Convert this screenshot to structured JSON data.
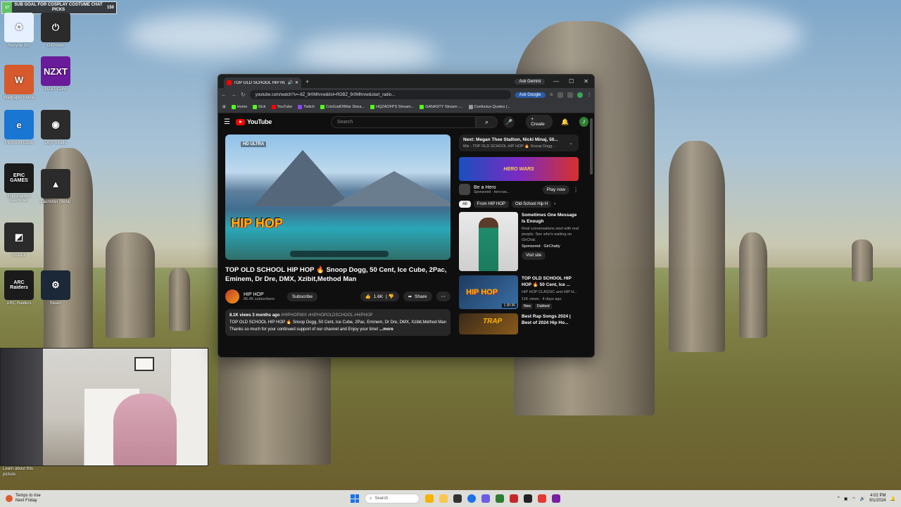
{
  "overlay": {
    "sub_goal_text": "SUB GOAL FOR COSPLAY COSTUME CHAT PICKS",
    "sub_goal_count": "150",
    "sub_goal_level": "17",
    "learn_more": "Learn about this picture"
  },
  "desktop_icons": [
    {
      "label": "Recycle Bin",
      "color": "#e6f0ff",
      "glyph": "♻"
    },
    {
      "label": "GitPower",
      "color": "#2b2b2b",
      "glyph": "⏻"
    },
    {
      "label": "Wallpaper Maste",
      "color": "#d65a2b",
      "glyph": "W"
    },
    {
      "label": "NZXT CAM",
      "color": "#6a1b9a",
      "glyph": "NZXT"
    },
    {
      "label": "Microsoft Edge",
      "color": "#1976d2",
      "glyph": "e"
    },
    {
      "label": "OBS Studio",
      "color": "#2b2b2b",
      "glyph": "◉"
    },
    {
      "label": "Epic Games Launcher",
      "color": "#1b1b1b",
      "glyph": "EPIC GAMES"
    },
    {
      "label": "Launcher (Beta)",
      "color": "#2b2b2b",
      "glyph": "▲"
    },
    {
      "label": "ShareX",
      "color": "#2b2b2b",
      "glyph": "◩"
    },
    {
      "label": "ARC Raiders",
      "color": "#1b1b1b",
      "glyph": "ARC Raiders"
    },
    {
      "label": "Steam",
      "color": "#1b2838",
      "glyph": "⚙"
    }
  ],
  "browser": {
    "tab_title": "TOP OLD SCHOOL HIP HOP",
    "new_tab": "+",
    "ask_gemini": "Ask Gemini",
    "url": "youtube.com/watch?v=-8Z_9r0Mhrvw&list=RDBZ_9r0Mhrvw&start_radio...",
    "ask_google": "Ask Google",
    "bookmarks": [
      {
        "label": "Home",
        "color": "green"
      },
      {
        "label": "Kick",
        "color": "green"
      },
      {
        "label": "YouTube",
        "color": "red"
      },
      {
        "label": "Twitch",
        "color": "purple"
      },
      {
        "label": "CrisGodOfWar Strea...",
        "color": "green"
      },
      {
        "label": "HQZAOFPS Stream...",
        "color": "green"
      },
      {
        "label": "GANASTY Stream -...",
        "color": "green"
      },
      {
        "label": "Confucius Quotes (...",
        "color": "gray"
      }
    ]
  },
  "youtube": {
    "logo": "YouTube",
    "search_placeholder": "Search",
    "create": "Create",
    "avatar_letter": "J",
    "player": {
      "hd_badge": "HD ULTRA",
      "overlay_text": "HIP HOP"
    },
    "video_title": "TOP OLD SCHOOL HIP HOP 🔥 Snoop Dogg, 50 Cent, Ice Cube, 2Pac, Eminem, Dr Dre, DMX, Xzibit,Method Man",
    "channel": {
      "name": "HIP HOP",
      "subs": "86.4K subscribers",
      "subscribe": "Subscribe"
    },
    "likes": "1.6K",
    "share": "Share",
    "description": {
      "meta": "8.1K views  3 months ago",
      "tags": "#HIPHOPMIX #HIPHOPOLDSCHOOL #HIPHOP",
      "line1": "TOP OLD SCHOOL HIP HOP 🔥 Snoop Dogg, 50 Cent, Ice Cube, 2Pac, Eminem, Dr Dre, DMX, Xzibit,Method Man",
      "line2": "Thanks so much for your continued support of our channel and Enjoy your time!",
      "more": "...more"
    },
    "next": {
      "title": "Next: Megan Thee Stallion, Nicki Minaj, 50...",
      "subtitle": "Mix - TOP OLD SCHOOL HIP HOP 🔥 Snoop Dogg..."
    },
    "ad": {
      "banner": "HERO WARS",
      "title": "Be a Hero",
      "sponsor": "Sponsored · hero-wa...",
      "play_now": "Play now"
    },
    "chips": [
      "All",
      "From HIP HOP",
      "Old-School Hip H"
    ],
    "recs": [
      {
        "title": "Sometimes One Message Is Enough",
        "sub": "Real conversations start with real people. See who's waiting on GirChat.",
        "sponsor": "Sponsored · GirChatty",
        "cta": "Visit site"
      },
      {
        "title": "TOP OLD SCHOOL HIP HOP 🔥 50 Cent, Ice ...",
        "sub": "HIP HOP CLASSIC and HIP H...",
        "meta": "11K views · 4 days ago",
        "badges": [
          "New",
          "Dubbed"
        ],
        "thumb_label": "HIP HOP",
        "duration": "1:30:36"
      },
      {
        "title": "Best Rap Songs 2024 | Best of 2024 Hip Ho...",
        "thumb_label": "TRAP"
      }
    ]
  },
  "taskbar": {
    "weather_line1": "Temps to rise",
    "weather_line2": "Next Friday",
    "search": "Search",
    "time": "4:02 PM",
    "date": "9/1/2024"
  }
}
